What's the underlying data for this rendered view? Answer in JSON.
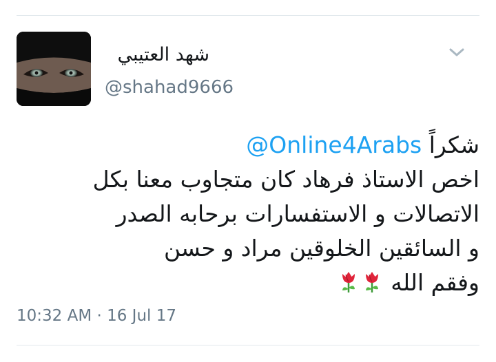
{
  "tweet": {
    "author": {
      "display_name": "شهد العتيبي",
      "handle": "@shahad9666",
      "avatar": "avatar-niqab-eyes"
    },
    "menu_icon": "chevron-down-icon",
    "text": {
      "line1_greeting": "شكراً",
      "line1_mention": "@Online4Arabs",
      "line2": "اخص الاستاذ فرهاد كان متجاوب معنا بكل",
      "line3": "الاتصالات و الاستفسارات برحابه الصدر",
      "line4": "و السائقين الخلوقين مراد و حسن",
      "line5": "وفقم الله",
      "line5_emoji": [
        "tulip-icon",
        "tulip-icon"
      ]
    },
    "timestamp": "10:32 AM · 16 Jul 17"
  },
  "colors": {
    "link": "#1da1f2",
    "text": "#14171a",
    "secondary": "#657786",
    "divider": "#e1e8ed"
  }
}
